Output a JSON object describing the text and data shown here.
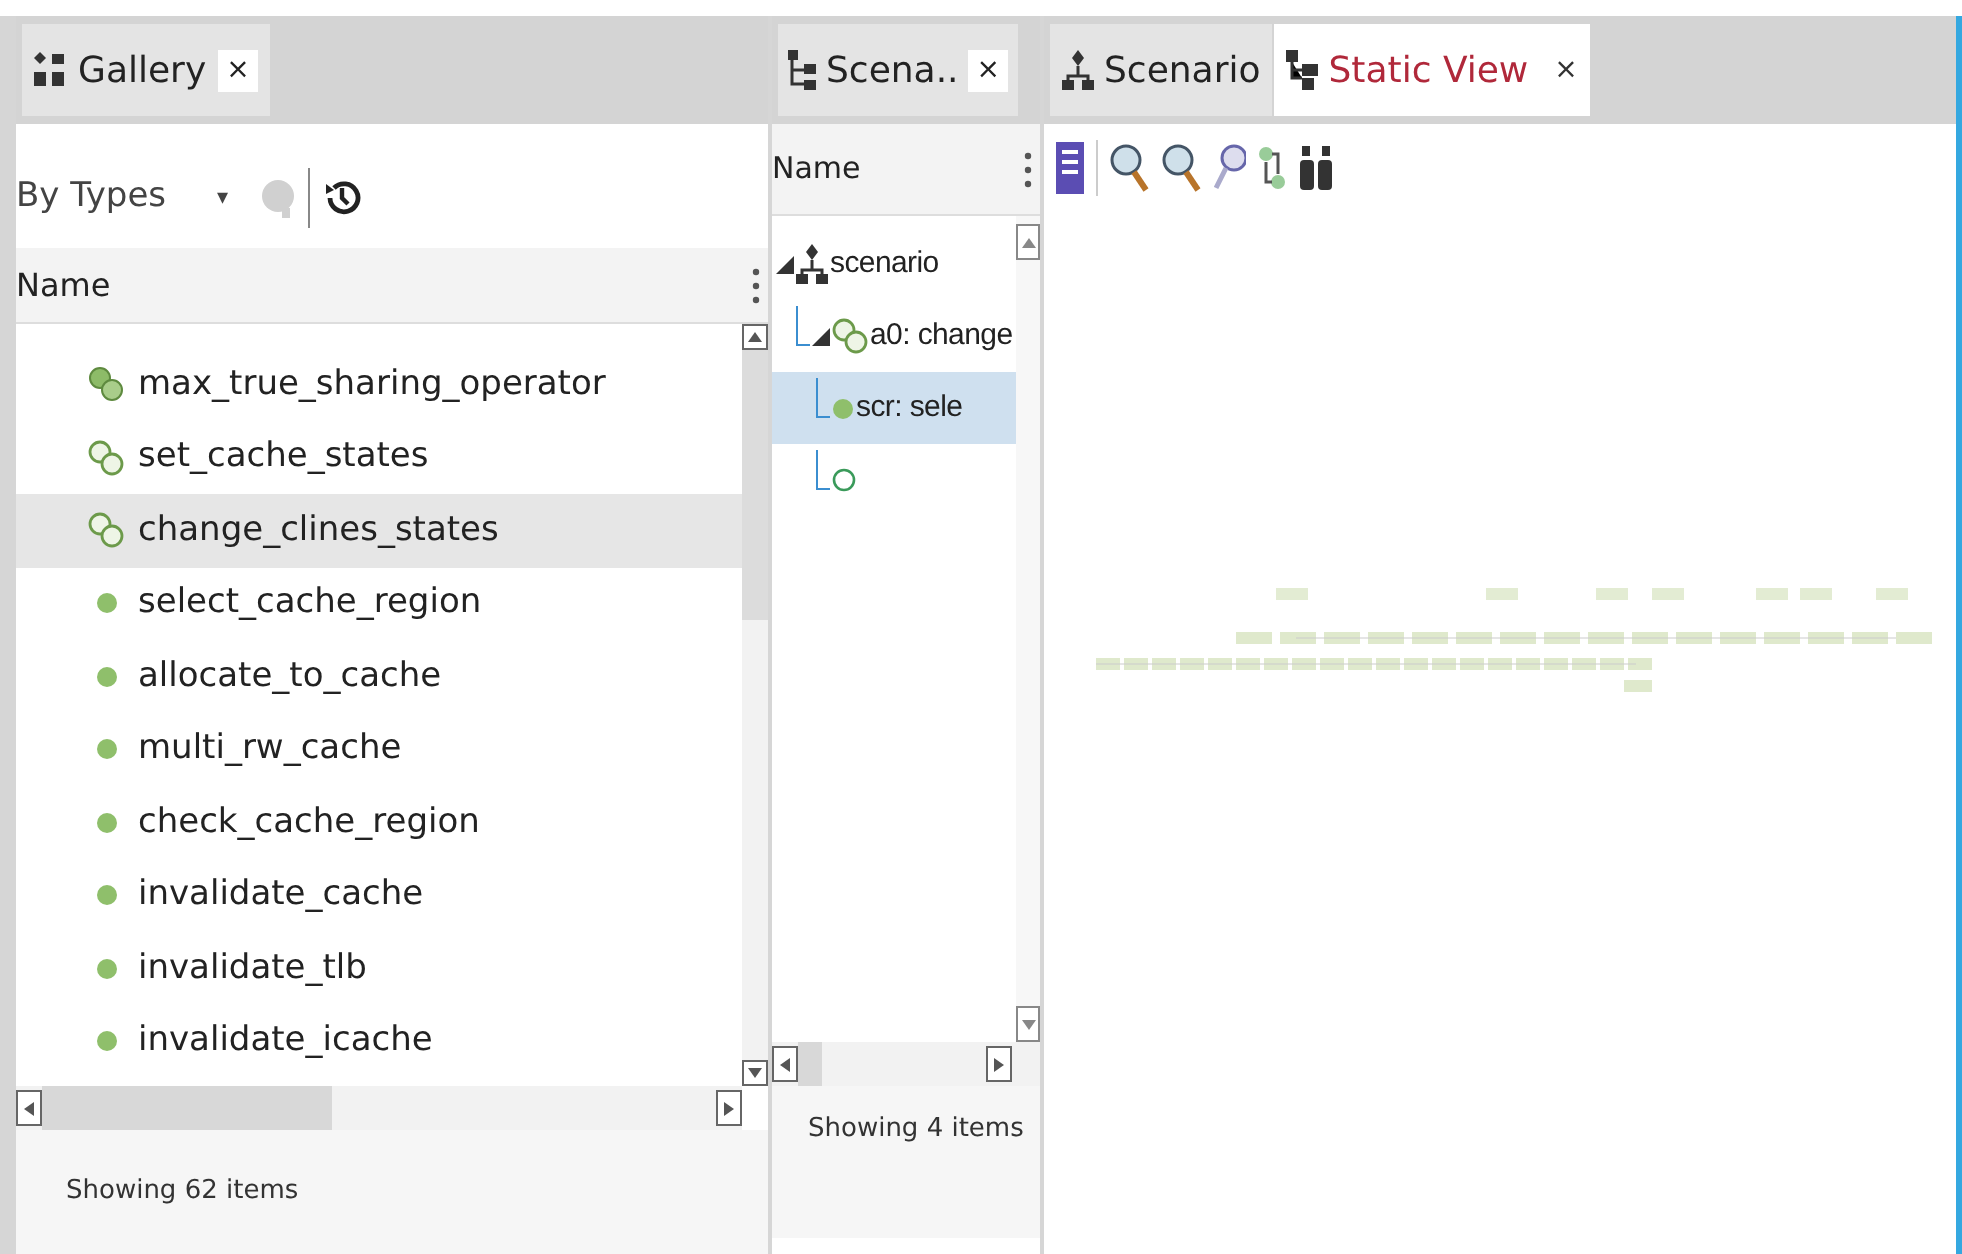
{
  "gallery": {
    "tab": {
      "label": "Gallery",
      "close": "×"
    },
    "filter": "By Types",
    "dropdown_caret": "▾",
    "column": "Name",
    "items": [
      {
        "label": "max_true_sharing_operator",
        "kind": "group",
        "selected": false
      },
      {
        "label": "set_cache_states",
        "kind": "group_outline",
        "selected": false
      },
      {
        "label": "change_clines_states",
        "kind": "group_outline",
        "selected": true
      },
      {
        "label": "select_cache_region",
        "kind": "action",
        "selected": false
      },
      {
        "label": "allocate_to_cache",
        "kind": "action",
        "selected": false
      },
      {
        "label": "multi_rw_cache",
        "kind": "action",
        "selected": false
      },
      {
        "label": "check_cache_region",
        "kind": "action",
        "selected": false
      },
      {
        "label": "invalidate_cache",
        "kind": "action",
        "selected": false
      },
      {
        "label": "invalidate_tlb",
        "kind": "action",
        "selected": false
      },
      {
        "label": "invalidate_icache",
        "kind": "action",
        "selected": false
      }
    ],
    "status": "Showing 62 items"
  },
  "scenario_tree": {
    "tab": {
      "label": "Scena..",
      "close": "×"
    },
    "column": "Name",
    "tree": [
      {
        "label": "scenario",
        "kind": "scenario",
        "selected": false,
        "expanded": true,
        "children": [
          {
            "label": "a0: change",
            "kind": "group_outline",
            "selected": false,
            "expanded": true,
            "children": [
              {
                "label": "scr: sele",
                "kind": "action",
                "selected": true
              },
              {
                "kind": "empty",
                "selected": false
              }
            ]
          }
        ]
      }
    ],
    "status": "Showing 4 items"
  },
  "editor": {
    "tabs": [
      {
        "label": "Scenario",
        "kind": "scenario",
        "selected": false
      },
      {
        "label": "Static View",
        "kind": "static",
        "selected": true,
        "close": "×"
      }
    ]
  }
}
